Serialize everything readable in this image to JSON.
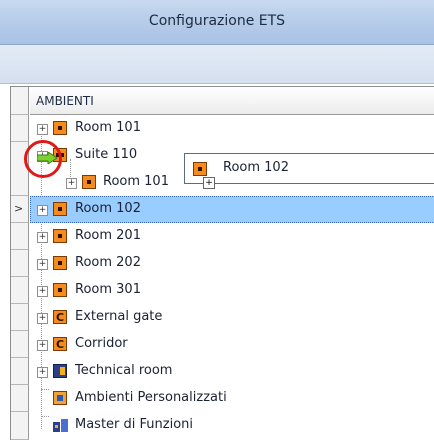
{
  "window": {
    "title": "Configurazione ETS"
  },
  "grid": {
    "column_header": "AMBIENTI",
    "rows": [
      {
        "label": "Room 101",
        "icon": "room-icon",
        "expander": "+"
      },
      {
        "label": "Suite 110",
        "icon": "suite-icon",
        "expander": "+"
      },
      {
        "label": "Room 101",
        "icon": "room-icon",
        "expander": "+"
      },
      {
        "label": "Room 102",
        "icon": "room-icon",
        "expander": "+",
        "selected": true
      },
      {
        "label": "Room 201",
        "icon": "room-icon",
        "expander": "+"
      },
      {
        "label": "Room 202",
        "icon": "room-icon",
        "expander": "+"
      },
      {
        "label": "Room 301",
        "icon": "room-icon",
        "expander": "+"
      },
      {
        "label": "External gate",
        "icon": "zone-c-icon",
        "expander": "+"
      },
      {
        "label": "Corridor",
        "icon": "zone-c-icon",
        "expander": "+"
      },
      {
        "label": "Technical room",
        "icon": "technical-room-icon",
        "expander": "+"
      },
      {
        "label": "Ambienti Personalizzati",
        "icon": "custom-rooms-icon"
      },
      {
        "label": "Master di Funzioni",
        "icon": "master-functions-icon"
      }
    ]
  },
  "drag_ghost": {
    "label": "Room 102",
    "expander": "+"
  },
  "row_pointer": ">",
  "colors": {
    "selection": "#99ccff",
    "highlight_circle": "#e01818",
    "room_icon": "#f58b1f"
  }
}
